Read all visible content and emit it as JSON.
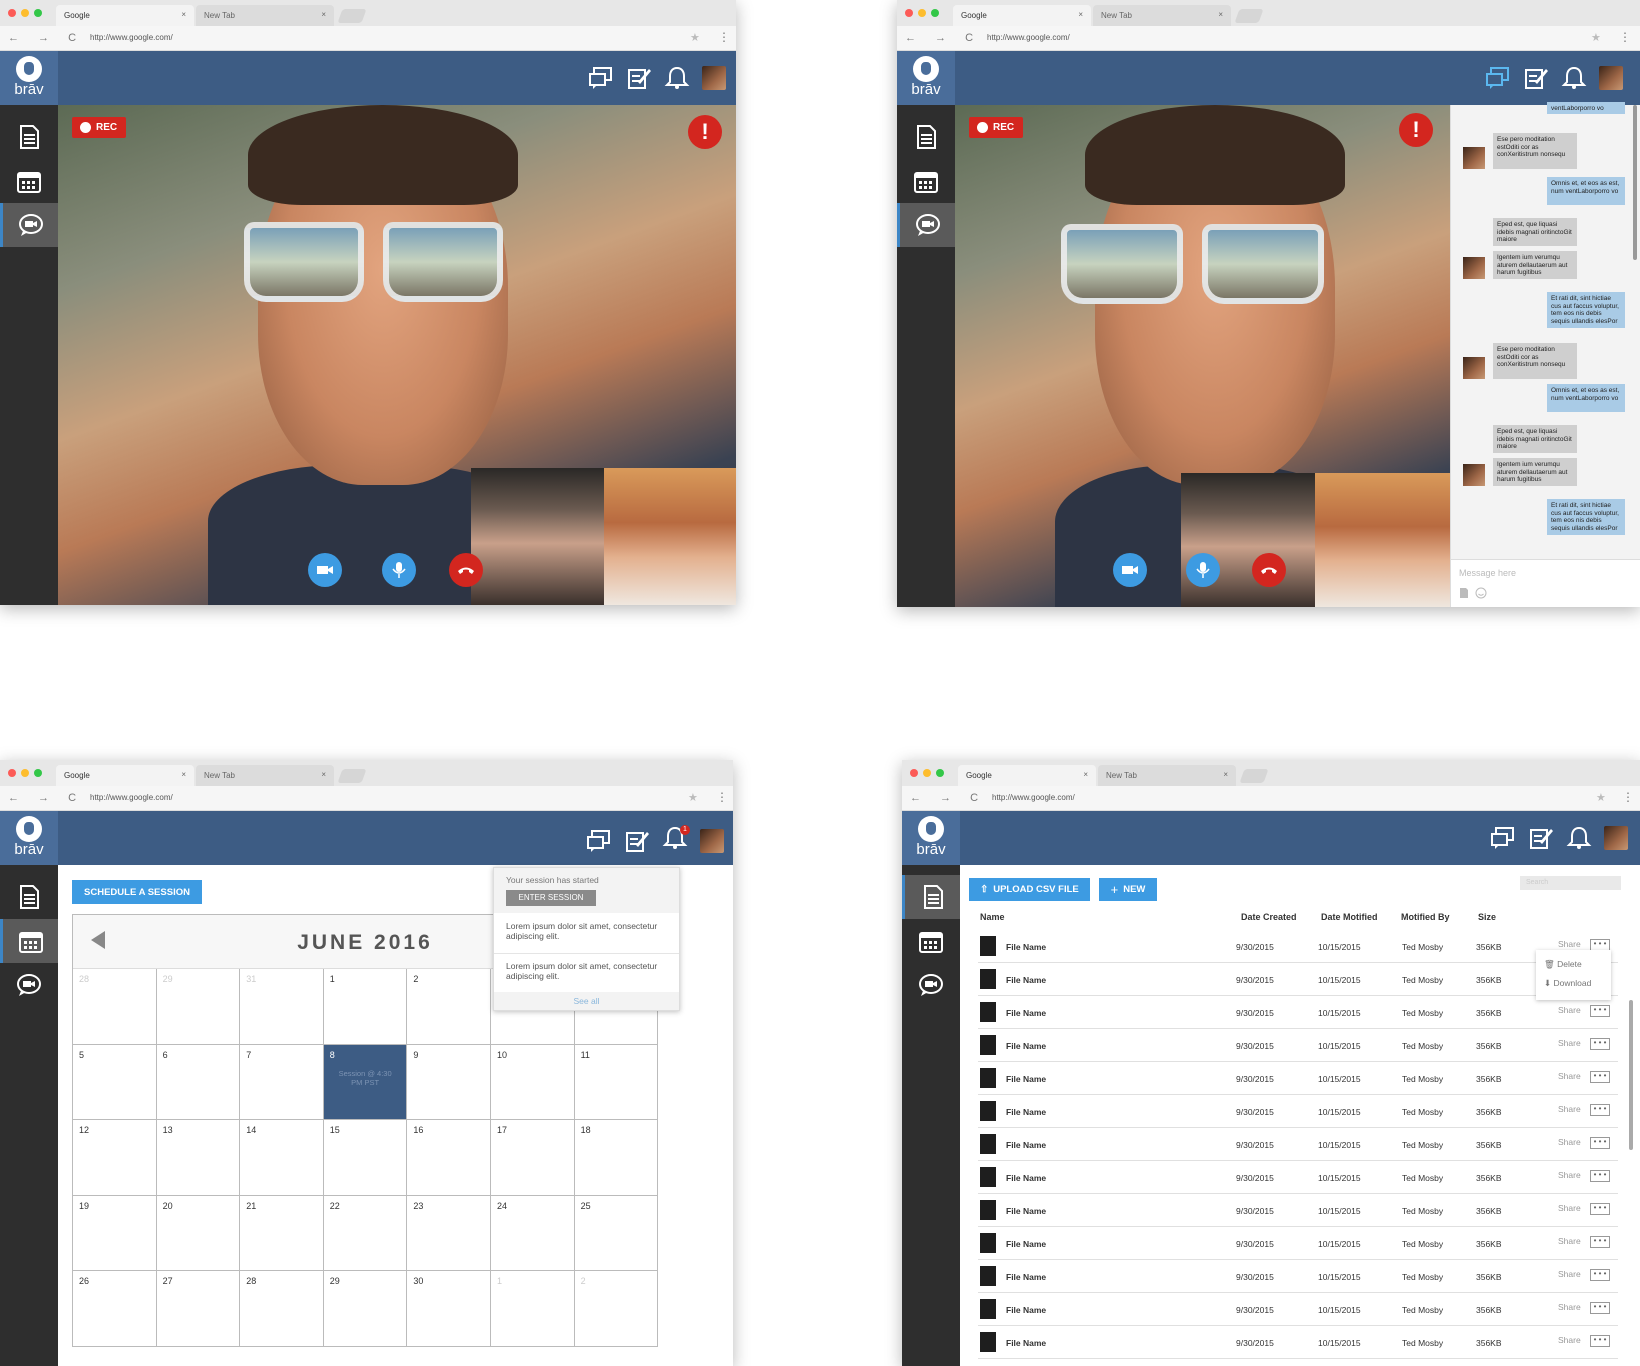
{
  "browser": {
    "tab1": "Google",
    "tab2": "New Tab",
    "tab_close": "×",
    "url": "http://www.google.com/",
    "nav": "← → C",
    "star": "★",
    "menu": "⋮"
  },
  "brand": {
    "logo_text": "brāv"
  },
  "colors": {
    "topbar": "#3d5c84",
    "sidebar": "#2e2e2e",
    "accent": "#3d9be2",
    "alert": "#d3261f"
  },
  "icons": {
    "sidebar": [
      "document-icon",
      "calendar-icon",
      "chat-video-icon"
    ],
    "topbar": [
      "messages-icon",
      "edit-notes-icon",
      "bell-icon",
      "user-avatar"
    ]
  },
  "video": {
    "rec_label": "REC",
    "alert_symbol": "!"
  },
  "chat": {
    "messages": [
      {
        "dir": "out",
        "text": "ventLaborporro vo"
      },
      {
        "dir": "in",
        "text": "Ese pero moditation estOditi cor as conXeritistrum nonsequ"
      },
      {
        "dir": "out",
        "text": "Omnis et, et eos as est, num ventLaborporro vo"
      },
      {
        "dir": "in",
        "text": "Eped est, que liquasi idebis magnati oritinctoGit maiore"
      },
      {
        "dir": "in",
        "text": "Igentem ium verumqu aturem dellautaerum aut harum fugitibus"
      },
      {
        "dir": "out",
        "text": "Et rati dit, sint hictiae cus aut faccus voluptur, tem eos nis debis sequis ullandis elesPor"
      },
      {
        "dir": "in",
        "text": "Ese pero moditation estOditi cor as conXeritistrum nonsequ"
      },
      {
        "dir": "out",
        "text": "Omnis et, et eos as est, num ventLaborporro vo"
      },
      {
        "dir": "in",
        "text": "Eped est, que liquasi idebis magnati oritinctoGit maiore"
      },
      {
        "dir": "in",
        "text": "Igentem ium verumqu aturem dellautaerum aut harum fugitibus"
      },
      {
        "dir": "out",
        "text": "Et rati dit, sint hictiae cus aut faccus voluptur, tem eos nis debis sequis ullandis elesPor"
      }
    ],
    "input_placeholder": "Message here"
  },
  "calendar": {
    "schedule_button": "SCHEDULE A SESSION",
    "month": "JUNE 2016",
    "weeks": [
      [
        {
          "d": "28",
          "dim": true
        },
        {
          "d": "29",
          "dim": true
        },
        {
          "d": "31",
          "dim": true
        },
        {
          "d": "1"
        },
        {
          "d": "2"
        },
        {
          "d": "3"
        },
        {
          "d": "4"
        }
      ],
      [
        {
          "d": "5"
        },
        {
          "d": "6"
        },
        {
          "d": "7"
        },
        {
          "d": "8",
          "hl": true,
          "note": "Session @ 4:30 PM PST"
        },
        {
          "d": "9"
        },
        {
          "d": "10"
        },
        {
          "d": "11"
        }
      ],
      [
        {
          "d": "12"
        },
        {
          "d": "13"
        },
        {
          "d": "14"
        },
        {
          "d": "15"
        },
        {
          "d": "16"
        },
        {
          "d": "17"
        },
        {
          "d": "18"
        }
      ],
      [
        {
          "d": "19"
        },
        {
          "d": "20"
        },
        {
          "d": "21"
        },
        {
          "d": "22"
        },
        {
          "d": "23"
        },
        {
          "d": "24"
        },
        {
          "d": "25"
        }
      ],
      [
        {
          "d": "26"
        },
        {
          "d": "27"
        },
        {
          "d": "28"
        },
        {
          "d": "29"
        },
        {
          "d": "30"
        },
        {
          "d": "1",
          "dim": true
        },
        {
          "d": "2",
          "dim": true
        }
      ]
    ],
    "notification": {
      "badge": "1",
      "session_started": "Your session has started",
      "enter_button": "ENTER SESSION",
      "item1": "Lorem ipsum dolor sit amet, consectetur adipiscing elit.",
      "item2": "Lorem ipsum dolor sit amet, consectetur adipiscing elit.",
      "see_all": "See all"
    }
  },
  "files": {
    "upload_button": "UPLOAD CSV FILE",
    "new_button": "NEW",
    "search_placeholder": "Search",
    "columns": [
      "Name",
      "Date Created",
      "Date Motified",
      "Motified By",
      "Size"
    ],
    "rows": [
      {
        "name": "File Name",
        "created": "9/30/2015",
        "modified": "10/15/2015",
        "by": "Ted Mosby",
        "size": "356KB"
      },
      {
        "name": "File Name",
        "created": "9/30/2015",
        "modified": "10/15/2015",
        "by": "Ted Mosby",
        "size": "356KB"
      },
      {
        "name": "File Name",
        "created": "9/30/2015",
        "modified": "10/15/2015",
        "by": "Ted Mosby",
        "size": "356KB"
      },
      {
        "name": "File Name",
        "created": "9/30/2015",
        "modified": "10/15/2015",
        "by": "Ted Mosby",
        "size": "356KB"
      },
      {
        "name": "File Name",
        "created": "9/30/2015",
        "modified": "10/15/2015",
        "by": "Ted Mosby",
        "size": "356KB"
      },
      {
        "name": "File Name",
        "created": "9/30/2015",
        "modified": "10/15/2015",
        "by": "Ted Mosby",
        "size": "356KB"
      },
      {
        "name": "File Name",
        "created": "9/30/2015",
        "modified": "10/15/2015",
        "by": "Ted Mosby",
        "size": "356KB"
      },
      {
        "name": "File Name",
        "created": "9/30/2015",
        "modified": "10/15/2015",
        "by": "Ted Mosby",
        "size": "356KB"
      },
      {
        "name": "File Name",
        "created": "9/30/2015",
        "modified": "10/15/2015",
        "by": "Ted Mosby",
        "size": "356KB"
      },
      {
        "name": "File Name",
        "created": "9/30/2015",
        "modified": "10/15/2015",
        "by": "Ted Mosby",
        "size": "356KB"
      },
      {
        "name": "File Name",
        "created": "9/30/2015",
        "modified": "10/15/2015",
        "by": "Ted Mosby",
        "size": "356KB"
      },
      {
        "name": "File Name",
        "created": "9/30/2015",
        "modified": "10/15/2015",
        "by": "Ted Mosby",
        "size": "356KB"
      },
      {
        "name": "File Name",
        "created": "9/30/2015",
        "modified": "10/15/2015",
        "by": "Ted Mosby",
        "size": "356KB"
      }
    ],
    "share_label": "Share",
    "more_label": "• • •",
    "context_delete": "Delete",
    "context_download": "Download"
  }
}
